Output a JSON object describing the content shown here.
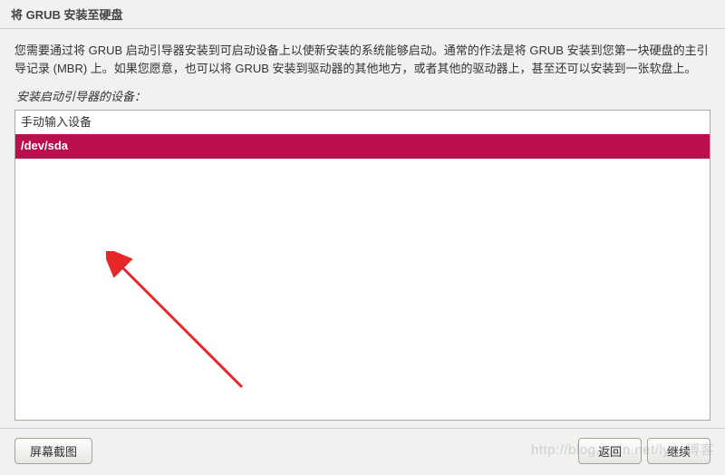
{
  "titlebar": {
    "title": "将 GRUB 安装至硬盘"
  },
  "description": "您需要通过将 GRUB 启动引导器安装到可启动设备上以使新安装的系统能够启动。通常的作法是将 GRUB 安装到您第一块硬盘的主引导记录 (MBR) 上。如果您愿意，也可以将 GRUB 安装到驱动器的其他地方，或者其他的驱动器上，甚至还可以安装到一张软盘上。",
  "subheading": "安装启动引导器的设备：",
  "device_list": {
    "items": [
      {
        "label": "手动输入设备",
        "selected": false
      },
      {
        "label": "/dev/sda",
        "selected": true
      }
    ]
  },
  "footer": {
    "screenshot_label": "屏幕截图",
    "back_label": "返回",
    "continue_label": "继续"
  },
  "colors": {
    "selection": "#ba0f4e"
  },
  "watermark": "http://blog.csdn.net/lya_博客"
}
